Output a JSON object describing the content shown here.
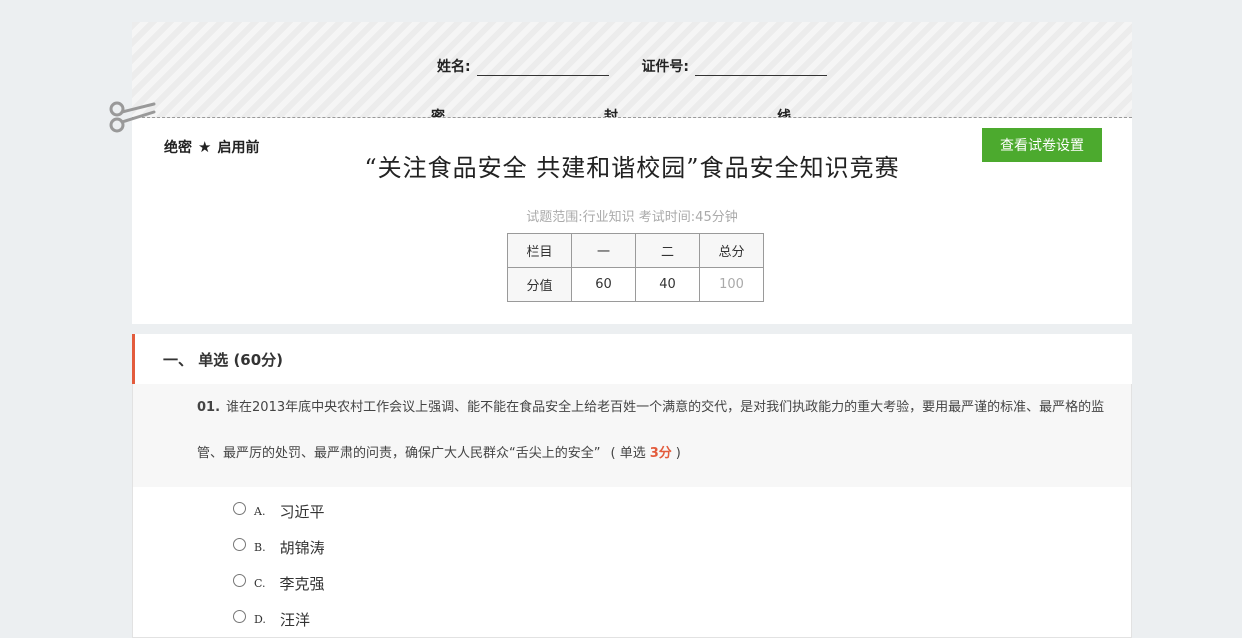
{
  "binding": {
    "name_label": "姓名:",
    "id_label": "证件号:",
    "seal": [
      "密",
      "封",
      "线"
    ]
  },
  "header": {
    "secret_label": "绝密",
    "secret_status": "启用前",
    "view_settings_button": "查看试卷设置",
    "title": "“关注食品安全  共建和谐校园”食品安全知识竞赛",
    "meta": "试题范围:行业知识  考试时间:45分钟",
    "score_table": {
      "header": [
        "栏目",
        "一",
        "二",
        "总分"
      ],
      "values": [
        "分值",
        "60",
        "40",
        "100"
      ]
    }
  },
  "section": {
    "title": "一、  单选  (60分)"
  },
  "question": {
    "number": "01.",
    "text": "谁在2013年底中央农村工作会议上强调、能不能在食品安全上给老百姓一个满意的交代，是对我们执政能力的重大考验，要用最严谨的标准、最严格的监管、最严厉的处罚、最严肃的问责，确保广大人民群众“舌尖上的安全”",
    "type_open": "(  单选",
    "points": "3分",
    "type_close": ")",
    "options": [
      {
        "letter": "A.",
        "text": "习近平"
      },
      {
        "letter": "B.",
        "text": "胡锦涛"
      },
      {
        "letter": "C.",
        "text": "李克强"
      },
      {
        "letter": "D.",
        "text": "汪洋"
      }
    ]
  },
  "colors": {
    "accent_green": "#4caa2e",
    "accent_red": "#e35b3c"
  }
}
